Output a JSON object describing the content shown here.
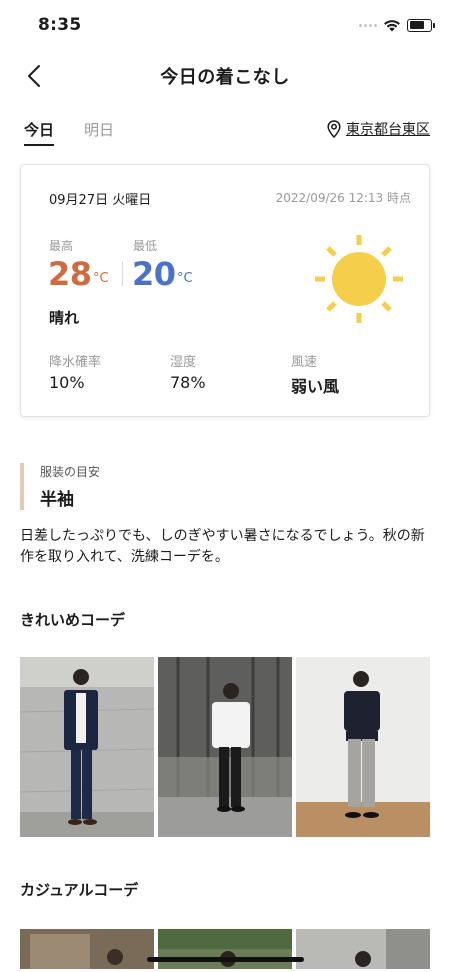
{
  "status_bar": {
    "time": "8:35"
  },
  "nav": {
    "title": "今日の着こなし"
  },
  "tabs": [
    {
      "label": "今日",
      "active": true
    },
    {
      "label": "明日",
      "active": false
    }
  ],
  "location": {
    "label": "東京都台東区",
    "icon": "location-pin-icon"
  },
  "weather": {
    "date": "09月27日 火曜日",
    "updated": "2022/09/26 12:13 時点",
    "max_label": "最高",
    "max_value": "28",
    "min_label": "最低",
    "min_value": "20",
    "unit": "°C",
    "condition": "晴れ",
    "icon": "sun-icon",
    "precip_label": "降水確率",
    "precip_value": "10%",
    "humidity_label": "湿度",
    "humidity_value": "78%",
    "wind_label": "風速",
    "wind_value": "弱い風",
    "colors": {
      "max": "#cf6b3e",
      "min": "#4a73c8",
      "sun": "#f5cf4b"
    }
  },
  "guide": {
    "label": "服装の目安",
    "value": "半袖",
    "accent": "#e7c8b4"
  },
  "description": "日差したっぷりでも、しのぎやすい暑さになるでしょう。秋の新作を取り入れて、洗練コーデを。",
  "sections": {
    "kirei": {
      "title": "きれいめコーデ"
    },
    "casual": {
      "title": "カジュアルコーデ"
    }
  }
}
